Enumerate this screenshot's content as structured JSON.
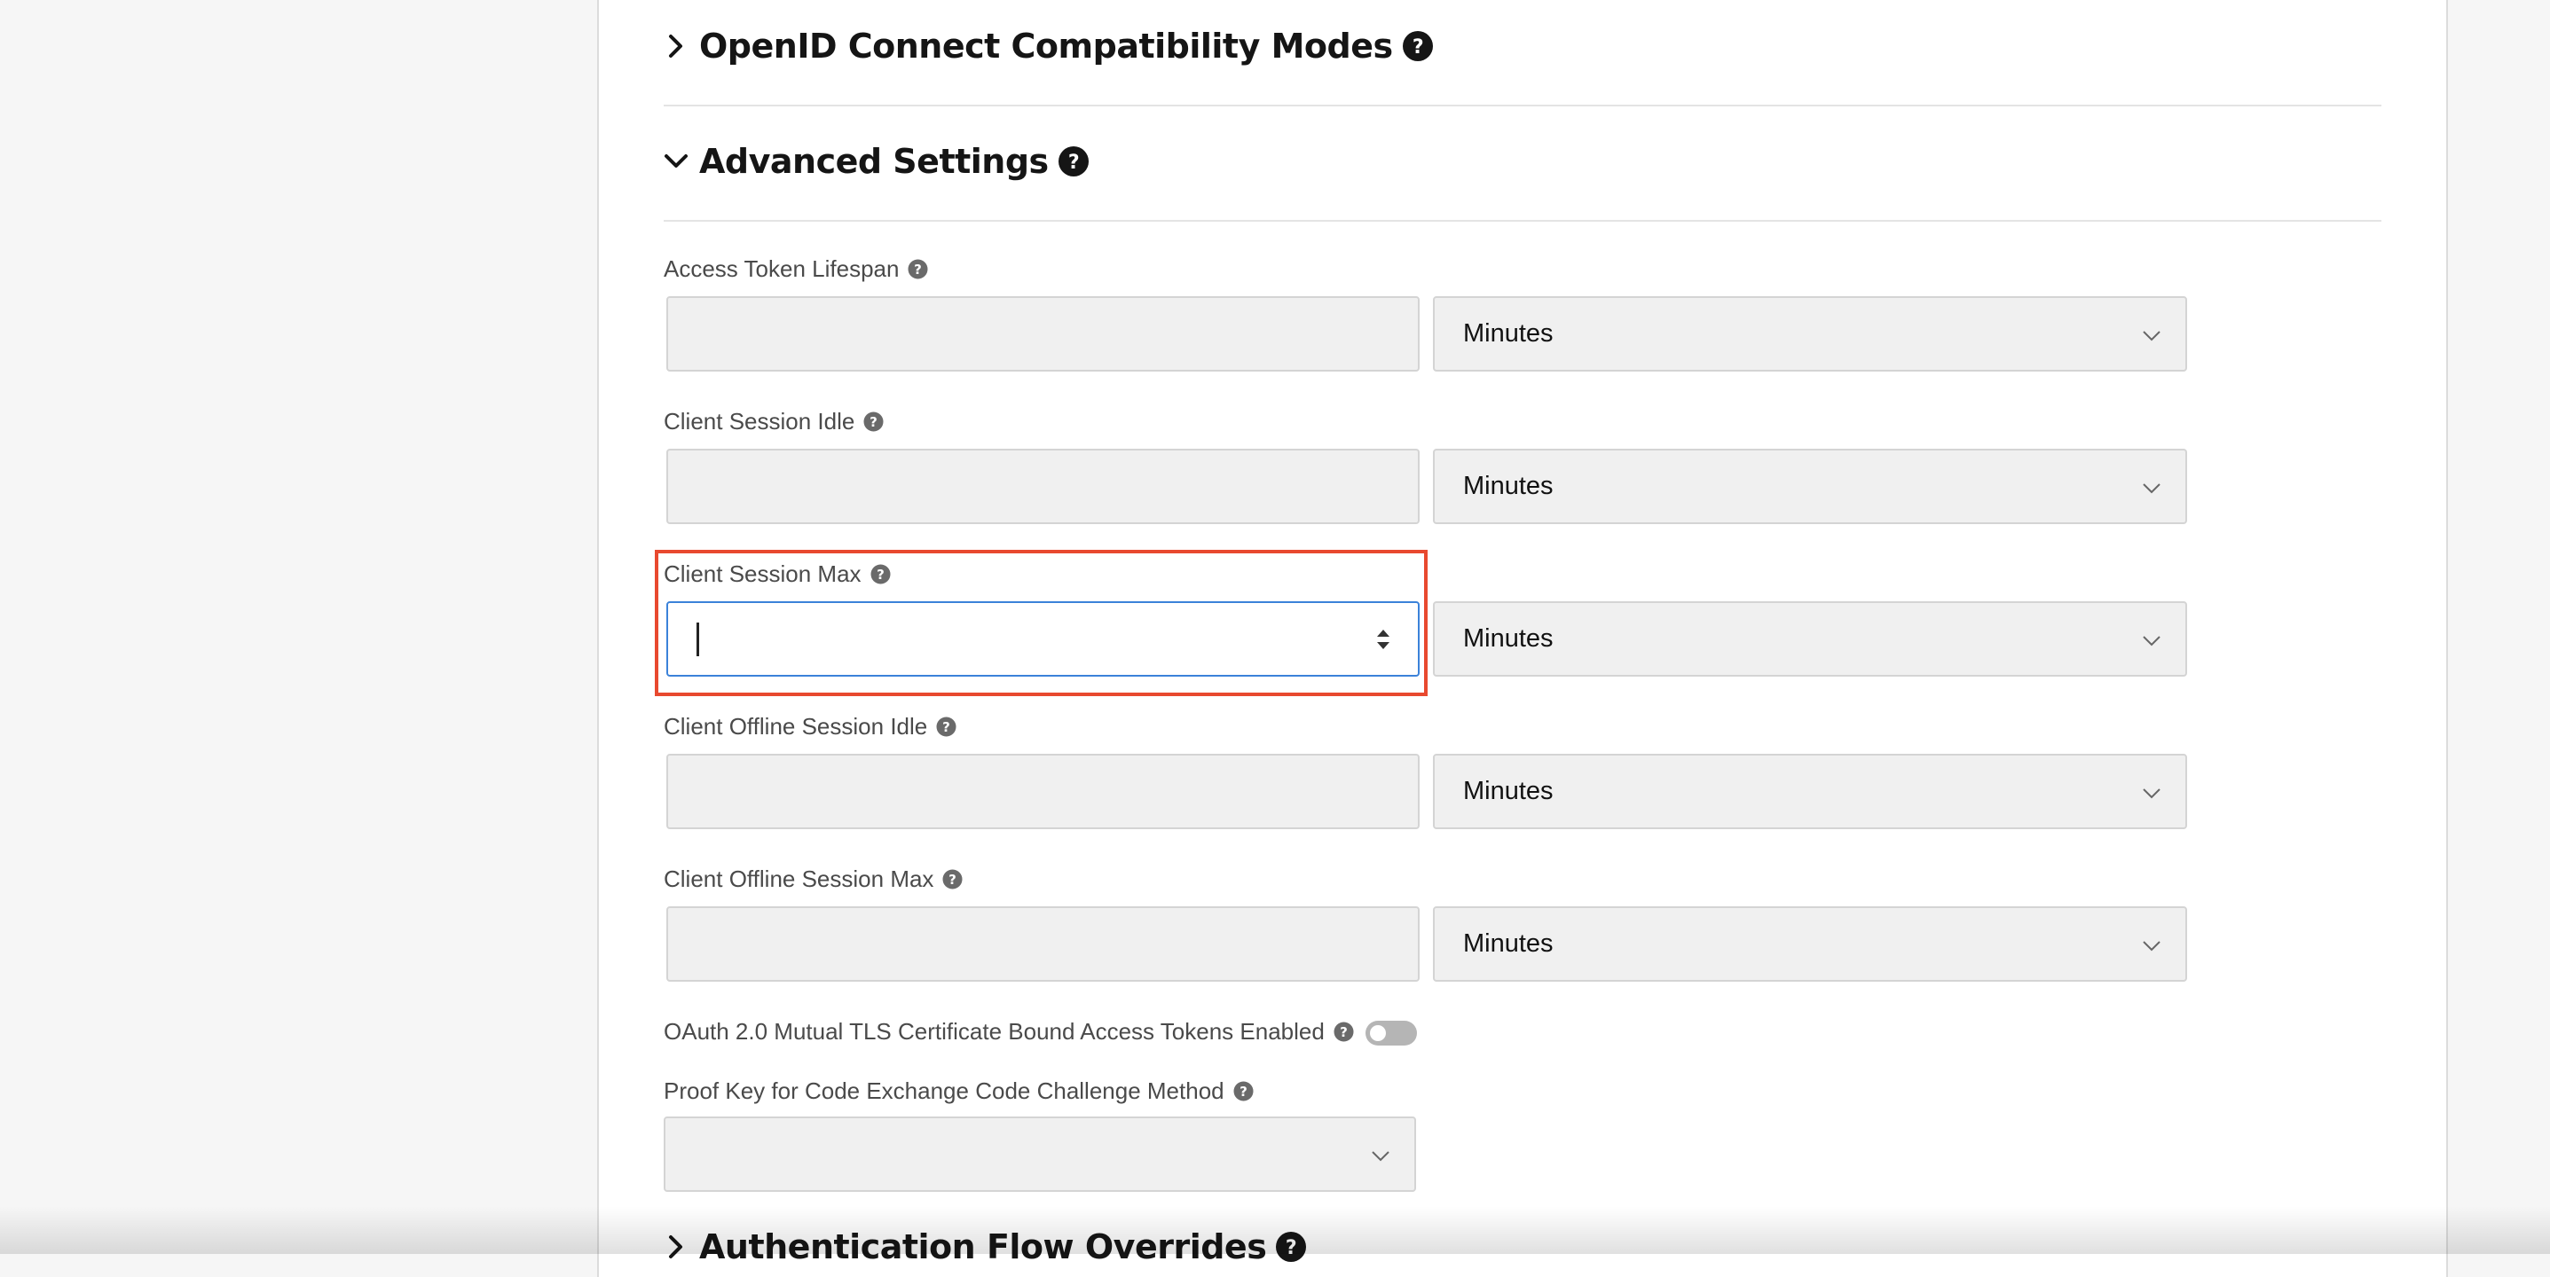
{
  "sections": {
    "openid_compat": {
      "title": "OpenID Connect Compatibility Modes",
      "expanded": false
    },
    "advanced": {
      "title": "Advanced Settings",
      "expanded": true
    },
    "auth_flow_overrides": {
      "title": "Authentication Flow Overrides",
      "expanded": false
    }
  },
  "fields": [
    {
      "label": "Access Token Lifespan",
      "value": "",
      "unit": "Minutes"
    },
    {
      "label": "Client Session Idle",
      "value": "",
      "unit": "Minutes"
    },
    {
      "label": "Client Session Max",
      "value": "",
      "unit": "Minutes",
      "focused": true
    },
    {
      "label": "Client Offline Session Idle",
      "value": "",
      "unit": "Minutes"
    },
    {
      "label": "Client Offline Session Max",
      "value": "",
      "unit": "Minutes"
    }
  ],
  "mtls": {
    "label": "OAuth 2.0 Mutual TLS Certificate Bound Access Tokens Enabled",
    "enabled": false
  },
  "pkce": {
    "label": "Proof Key for Code Exchange Code Challenge Method",
    "value": ""
  },
  "colors": {
    "highlight": "#e8492f",
    "focus_border": "#3b82d9",
    "toggle_off": "#b5b5b5"
  },
  "icons": {
    "collapsed": "chevron-right-icon",
    "expanded": "chevron-down-icon",
    "help": "question-circle-icon",
    "select": "chevron-down-icon",
    "spinner": "number-spinner-icon"
  }
}
